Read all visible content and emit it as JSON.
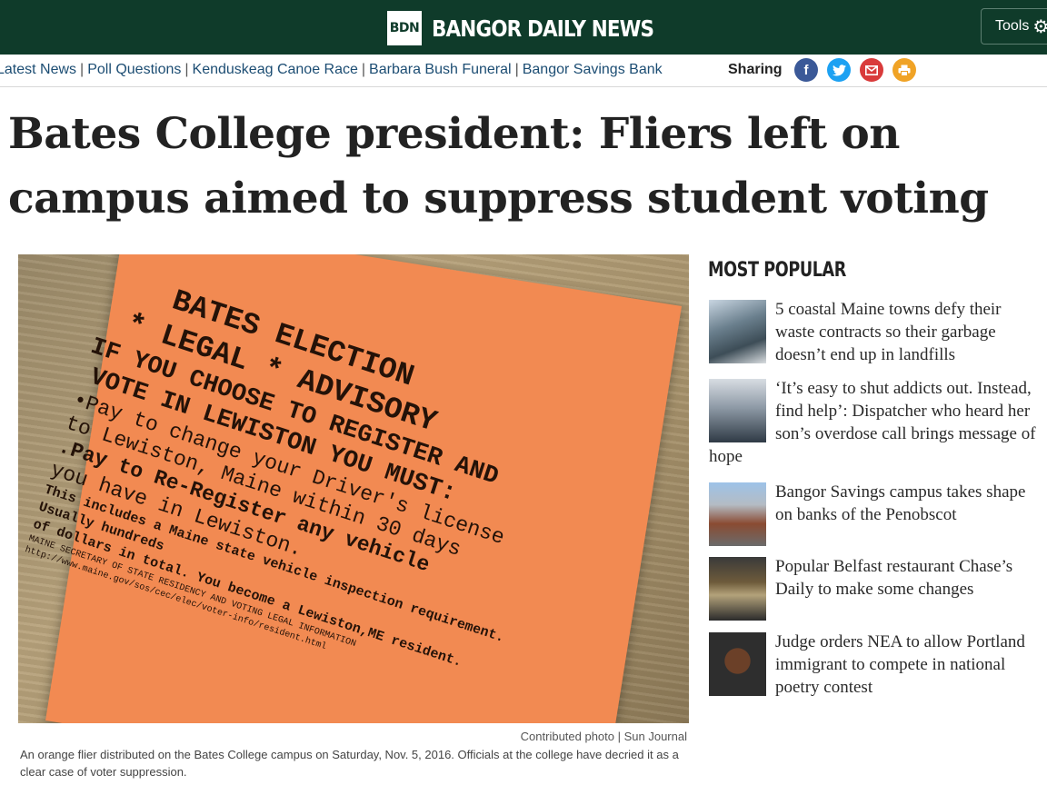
{
  "header": {
    "logo_abbr": "BDN",
    "site_name": "BANGOR DAILY NEWS",
    "tools_label": "Tools"
  },
  "nav": {
    "links": [
      "Latest News",
      "Poll Questions",
      "Kenduskeag Canoe Race",
      "Barbara Bush Funeral",
      "Bangor Savings Bank"
    ],
    "separator": "|",
    "sharing_label": "Sharing",
    "share_icons": [
      "facebook-icon",
      "twitter-icon",
      "email-icon",
      "print-icon"
    ]
  },
  "article": {
    "headline": "Bates College president: Fliers left on campus aimed to suppress student voting",
    "photo_credit": "Contributed photo | Sun Journal",
    "caption": "An orange flier distributed on the Bates College campus on Saturday, Nov. 5, 2016. Officials at the college have decried it as a clear case of voter suppression."
  },
  "flier": {
    "line1": "BATES ELECTION",
    "line2": "* LEGAL * ADVISORY",
    "line3": "IF YOU CHOOSE TO REGISTER AND",
    "line4": "VOTE IN LEWISTON YOU MUST:",
    "line5": "•Pay to change your Driver's license",
    "line6": "to Lewiston, Maine within 30 days",
    "line7": ".Pay to Re-Register any vehicle",
    "line8": "you have in Lewiston.",
    "line9": "This includes a Maine state vehicle inspection requirement. Usually hundreds",
    "line10": "of dollars in total. You become a Lewiston,ME resident.",
    "line11": "MAINE SECRETARY OF STATE RESIDENCY AND VOTING LEGAL INFORMATION",
    "line12": "http://www.maine.gov/sos/cec/elec/voter-info/resident.html"
  },
  "most_popular": {
    "title": "MOST POPULAR",
    "items": [
      "5 coastal Maine towns defy their waste contracts so their garbage doesn’t end up in landfills",
      "‘It’s easy to shut addicts out. Instead, find help’: Dispatcher who heard her son’s overdose call brings message of hope",
      "Bangor Savings campus takes shape on banks of the Penobscot",
      "Popular Belfast restaurant Chase’s Daily to make some changes",
      "Judge orders NEA to allow Portland immigrant to compete in national poetry contest"
    ]
  },
  "colors": {
    "header_bg": "#0f3b2a",
    "nav_link": "#1c4d73",
    "flier_orange": "#f28a52"
  }
}
